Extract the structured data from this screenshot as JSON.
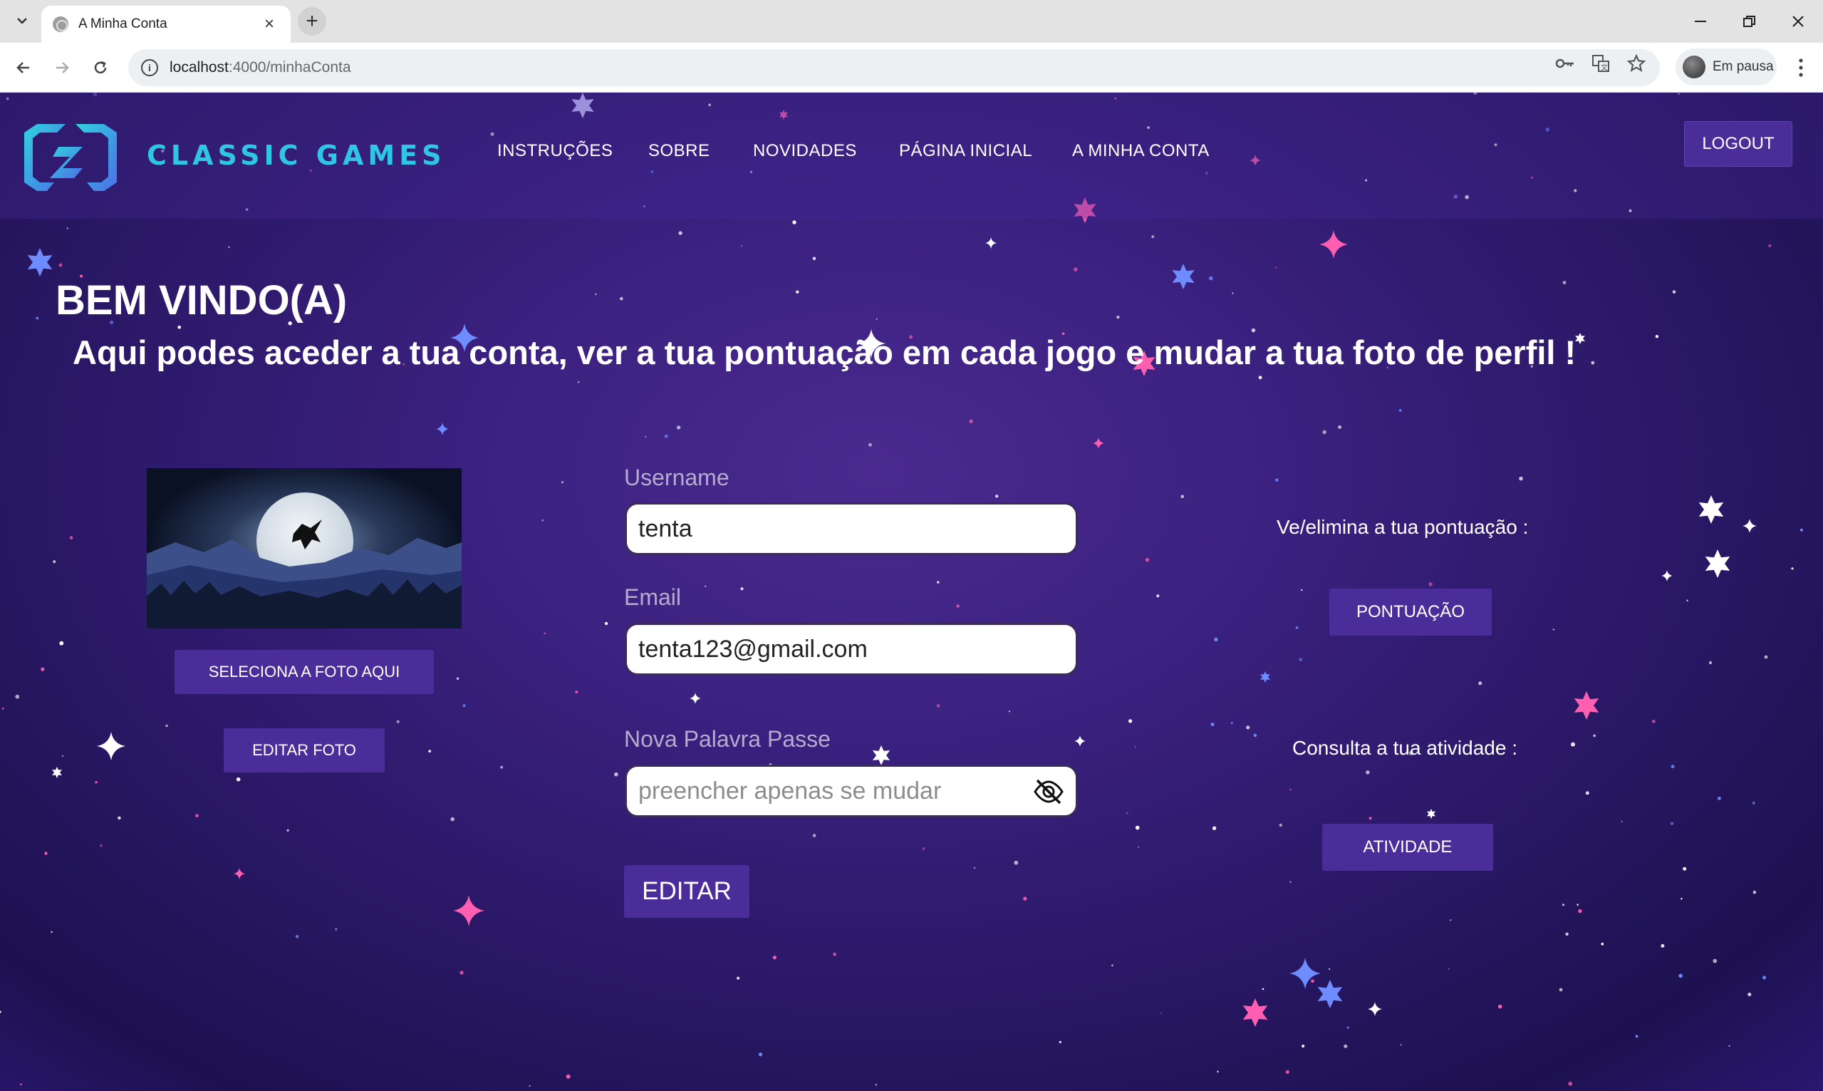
{
  "browser": {
    "tab_title": "A Minha Conta",
    "url_host": "localhost",
    "url_rest": ":4000/minhaConta",
    "profile_status": "Em pausa",
    "icons": [
      "tab-list-icon",
      "favicon-icon",
      "close-icon",
      "plus-icon",
      "minimize-icon",
      "restore-icon",
      "window-close-icon",
      "back-icon",
      "forward-icon",
      "reload-icon",
      "site-info-icon",
      "key-icon",
      "translate-icon",
      "star-icon",
      "kebab-menu-icon"
    ]
  },
  "header": {
    "brand": "CLASSIC GAMES",
    "nav": [
      "INSTRUÇÕES",
      "SOBRE",
      "NOVIDADES",
      "PÁGINA INICIAL",
      "A MINHA CONTA"
    ],
    "logout": "LOGOUT"
  },
  "welcome": {
    "title": "BEM VINDO(A)",
    "subtitle": "Aqui podes aceder a tua conta, ver a tua pontuação em cada jogo e mudar a tua foto de perfil !"
  },
  "photo": {
    "select_label": "SELECIONA A FOTO AQUI",
    "edit_label": "EDITAR FOTO"
  },
  "form": {
    "username_label": "Username",
    "username_value": "tenta",
    "email_label": "Email",
    "email_value": "tenta123@gmail.com",
    "password_label": "Nova Palavra Passe",
    "password_placeholder": "preencher apenas se mudar",
    "submit_label": "EDITAR"
  },
  "side": {
    "score_text": "Ve/elimina a tua pontuação :",
    "score_button": "PONTUAÇÃO",
    "activity_text": "Consulta a tua atividade :",
    "activity_button": "ATIVIDADE"
  },
  "colors": {
    "accent_button": "#4b2d99",
    "brand_text": "#2fc6e6",
    "page_bg": "#2a1866"
  }
}
